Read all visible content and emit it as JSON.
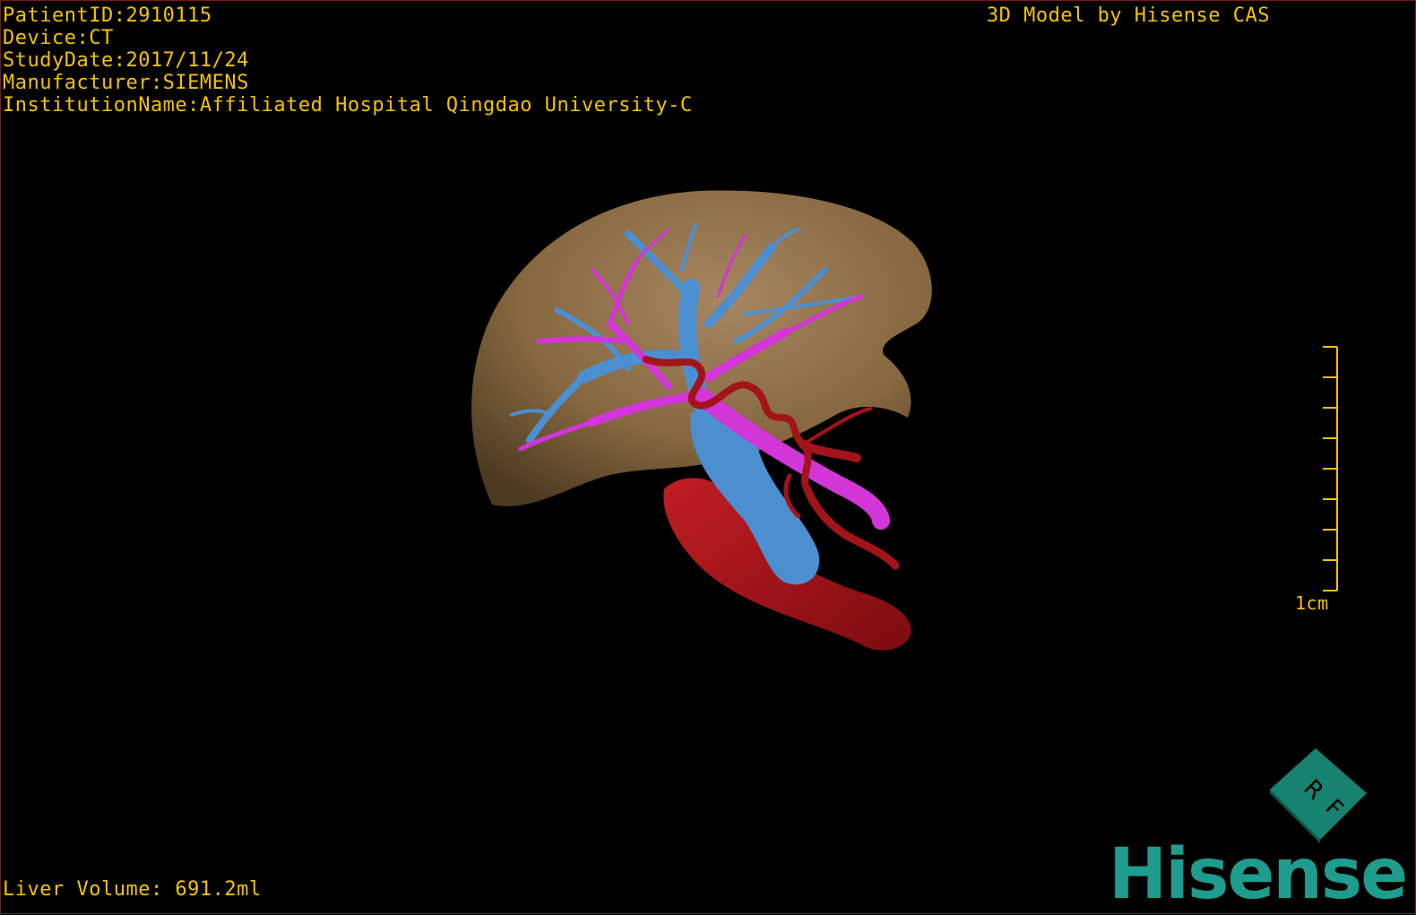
{
  "info": {
    "patient_id": "PatientID:2910115",
    "device": "Device:CT",
    "study_date": "StudyDate:2017/11/24",
    "manufacturer": "Manufacturer:SIEMENS",
    "institution": "InstitutionName:Affiliated Hospital Qingdao University-C"
  },
  "credit": "3D Model by Hisense CAS",
  "scale_bar": {
    "label": "1cm"
  },
  "liver_volume": "Liver Volume: 691.2ml",
  "orientation_cube": {
    "labels": [
      "R",
      "F"
    ]
  },
  "logo_text": "Hisense",
  "colors": {
    "overlay_text": "#f2c200",
    "liver": "#8a6c48",
    "portal_vein": "#4c8fd0",
    "hepatic_vein": "#d235d8",
    "artery_aorta": "#a3141a",
    "cube": "#17826f",
    "logo": "#1e9c8e",
    "frame_border": "#7a1a1a"
  }
}
